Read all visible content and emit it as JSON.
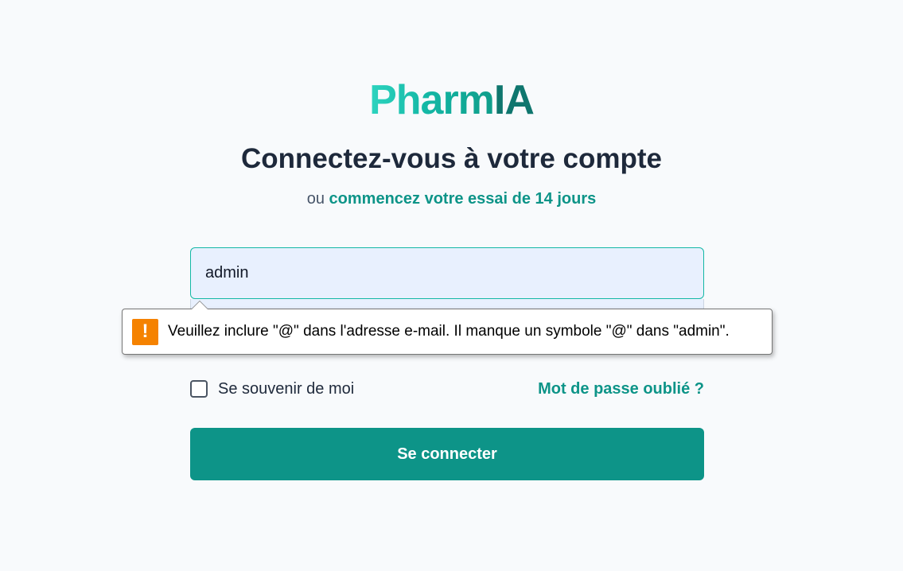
{
  "brand": {
    "part1": "Pharm",
    "part2": "IA"
  },
  "heading": "Connectez-vous à votre compte",
  "subline": {
    "prefix": "ou",
    "link": "commencez votre essai de 14 jours"
  },
  "email": {
    "value": "admin"
  },
  "validation": {
    "message": "Veuillez inclure \"@\" dans l'adresse e-mail. Il manque un symbole \"@\" dans \"admin\".",
    "icon": "warning-icon",
    "icon_glyph": "!",
    "icon_color": "#f58200"
  },
  "remember": {
    "label": "Se souvenir de moi",
    "checked": false
  },
  "forgot": {
    "label": "Mot de passe oublié ?"
  },
  "submit": {
    "label": "Se connecter"
  },
  "colors": {
    "accent": "#0d9488",
    "heading": "#1e293b",
    "input_bg": "#e8f0fe"
  }
}
